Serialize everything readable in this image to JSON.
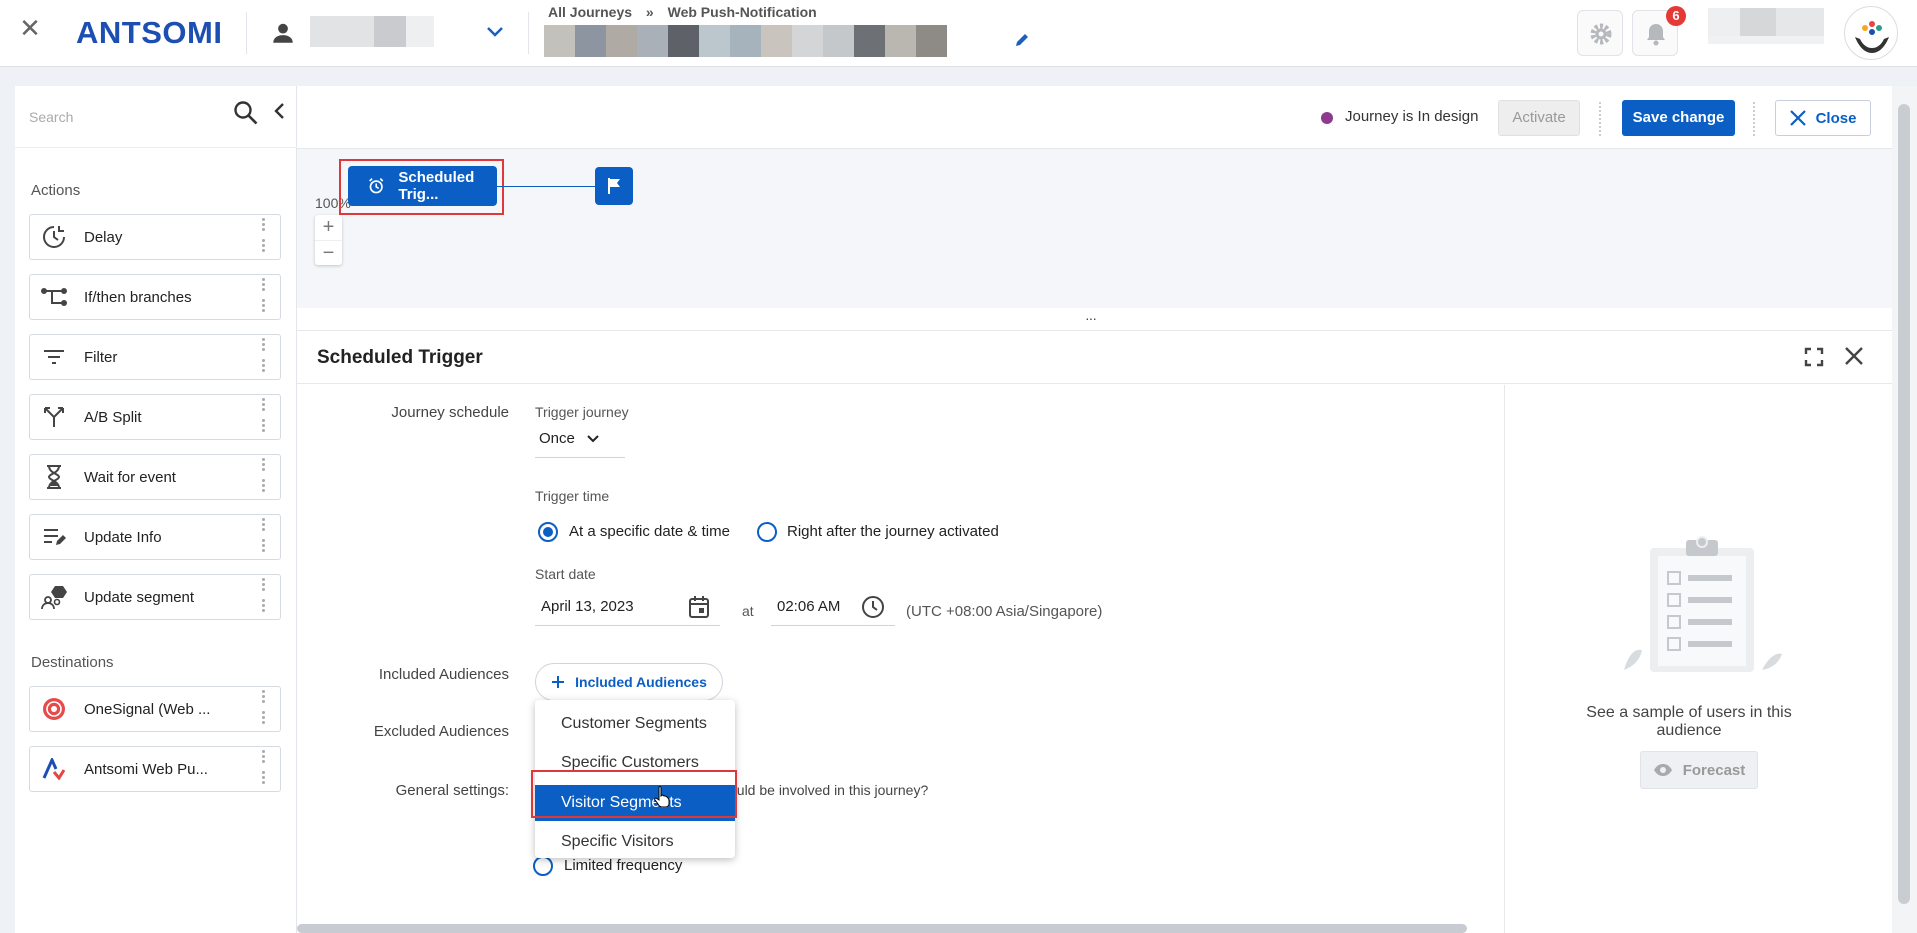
{
  "topbar": {
    "logo": "ANTSOMI",
    "breadcrumb": [
      "All Journeys",
      "»",
      "Web Push-Notification"
    ],
    "notification_count": "6"
  },
  "sidebar": {
    "search_placeholder": "Search",
    "actions_title": "Actions",
    "actions": [
      {
        "label": "Delay",
        "icon": "delay-icon"
      },
      {
        "label": "If/then branches",
        "icon": "branch-icon"
      },
      {
        "label": "Filter",
        "icon": "filter-icon"
      },
      {
        "label": "A/B Split",
        "icon": "split-icon"
      },
      {
        "label": "Wait for event",
        "icon": "hourglass-icon"
      },
      {
        "label": "Update Info",
        "icon": "edit-list-icon"
      },
      {
        "label": "Update segment",
        "icon": "segment-icon"
      }
    ],
    "destinations_title": "Destinations",
    "destinations": [
      {
        "label": "OneSignal (Web ...",
        "icon": "onesignal-icon"
      },
      {
        "label": "Antsomi Web Pu...",
        "icon": "antsomi-icon"
      }
    ]
  },
  "header": {
    "status": "Journey is In design",
    "activate_label": "Activate",
    "save_label": "Save change",
    "close_label": "Close"
  },
  "canvas": {
    "trigger_node_label": "Scheduled Trig...",
    "zoom": "100%"
  },
  "panel": {
    "title": "Scheduled Trigger",
    "journey_schedule_label": "Journey schedule",
    "trigger_journey_label": "Trigger journey",
    "trigger_journey_value": "Once",
    "trigger_time_label": "Trigger time",
    "radio_specific": "At a specific date & time",
    "radio_after_activated": "Right after the journey activated",
    "start_date_label": "Start date",
    "start_date_value": "April 13, 2023",
    "at_label": "at",
    "time_value": "02:06 AM",
    "timezone": "(UTC +08:00 Asia/Singapore)",
    "included_audiences_label": "Included Audiences",
    "included_audiences_button": "Included Audiences",
    "excluded_audiences_label": "Excluded Audiences",
    "general_settings_label": "General settings:",
    "general_question_partial": "ould be involved in this journey?",
    "limited_frequency": "Limited frequency",
    "dropdown_options": [
      "Customer Segments",
      "Specific Customers",
      "Visitor Segments",
      "Specific Visitors"
    ],
    "dropdown_selected": "Visitor Segments",
    "sample_text": "See a sample of users in this audience",
    "forecast_label": "Forecast"
  },
  "colors": {
    "primary": "#0b5fc4",
    "status_dot": "#8e3a8e",
    "highlight_box": "#e0373b"
  }
}
